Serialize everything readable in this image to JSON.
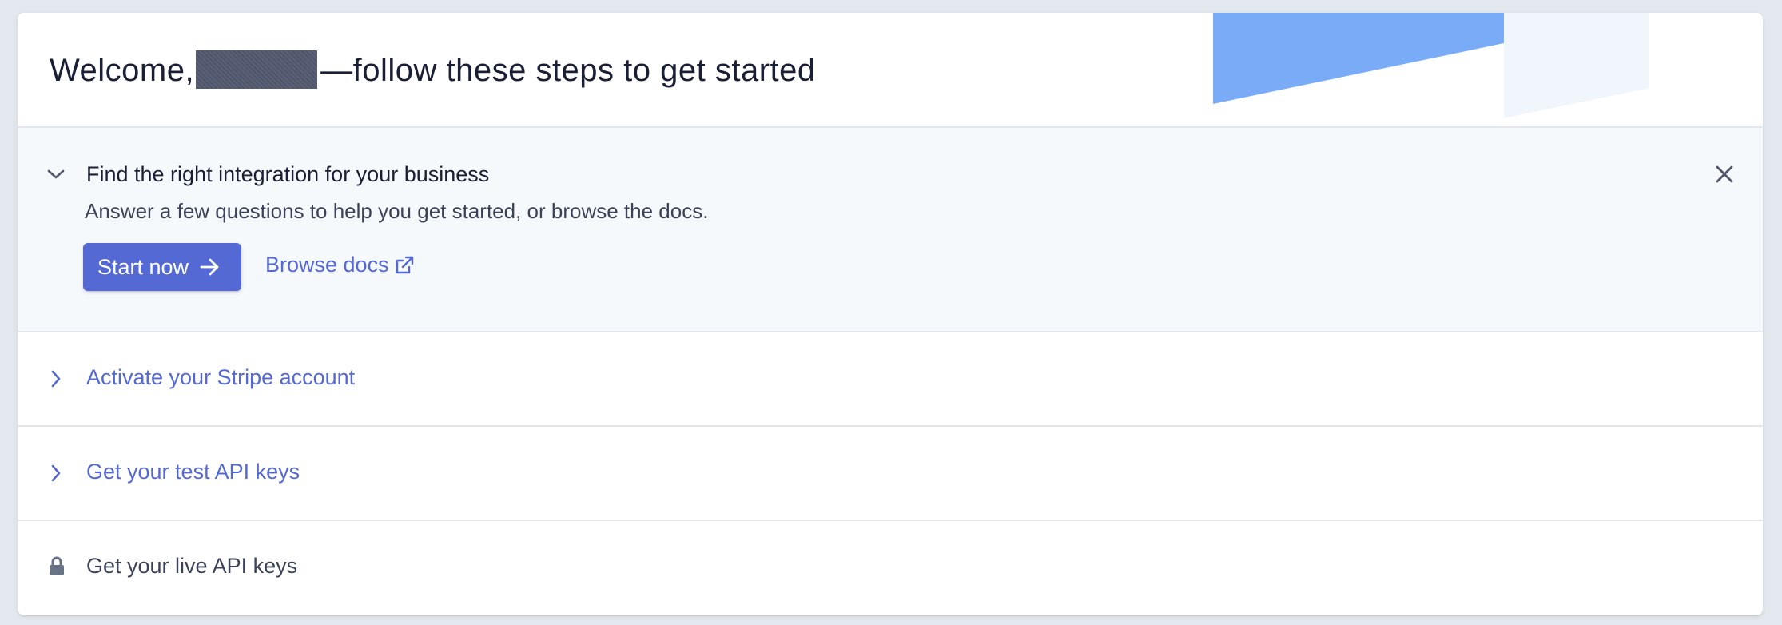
{
  "header": {
    "greeting": "Welcome,",
    "greeting_suffix": "—follow these steps to get started"
  },
  "integration": {
    "title": "Find the right integration for your business",
    "description": "Answer a few questions to help you get started, or browse the docs.",
    "start_button": "Start now",
    "docs_link": "Browse docs"
  },
  "steps": [
    {
      "label": "Activate your Stripe account",
      "icon": "chevron-right-icon"
    },
    {
      "label": "Get your test API keys",
      "icon": "chevron-right-icon"
    },
    {
      "label": "Get your live API keys",
      "icon": "lock-icon"
    }
  ],
  "colors": {
    "accent": "#5469d4",
    "page_background": "#e3e8ee",
    "decoration_blue": "#7aabf7",
    "text": "#1a1f36"
  }
}
